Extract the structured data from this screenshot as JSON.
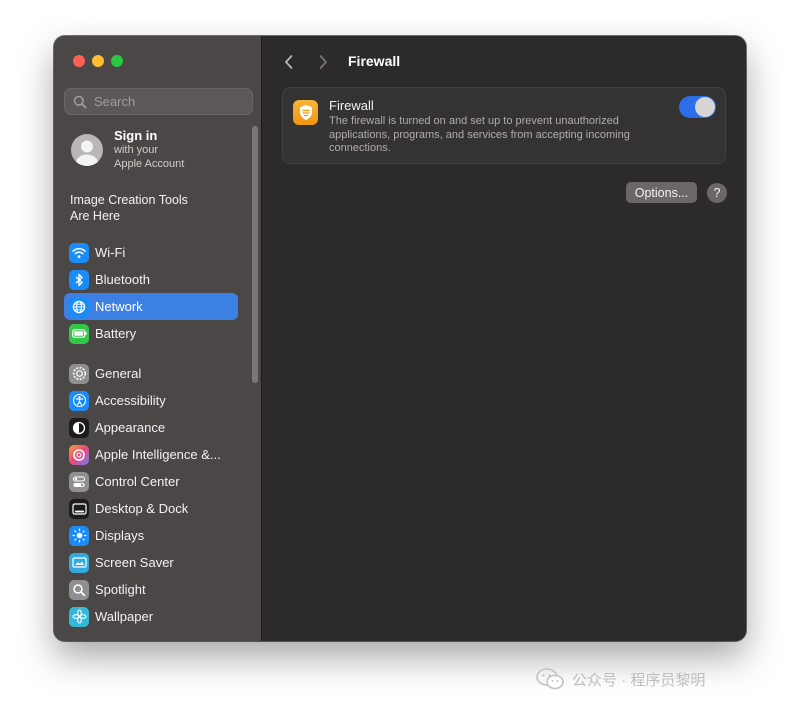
{
  "window": {
    "title": "Firewall"
  },
  "sidebar": {
    "search_placeholder": "Search",
    "account": {
      "title": "Sign in",
      "subtitle_line1": "with your",
      "subtitle_line2": "Apple Account"
    },
    "promo_line1": "Image Creation Tools",
    "promo_line2": "Are Here",
    "group1": [
      {
        "label": "Wi-Fi",
        "icon": "wifi-icon",
        "color": "#1a8cf8",
        "selected": false
      },
      {
        "label": "Bluetooth",
        "icon": "bluetooth-icon",
        "color": "#1a8cf8",
        "selected": false
      },
      {
        "label": "Network",
        "icon": "globe-icon",
        "color": "#1a8cf8",
        "selected": true
      },
      {
        "label": "Battery",
        "icon": "battery-icon",
        "color": "#33c748",
        "selected": false
      }
    ],
    "group2": [
      {
        "label": "General",
        "icon": "gear-icon",
        "color": "#8e8e93",
        "selected": false
      },
      {
        "label": "Accessibility",
        "icon": "accessibility-icon",
        "color": "#1a8cf8",
        "selected": false
      },
      {
        "label": "Appearance",
        "icon": "appearance-icon",
        "color": "#1c1c1e",
        "selected": false
      },
      {
        "label": "Apple Intelligence &...",
        "icon": "apple-intelligence-icon",
        "color": "#e85d8a",
        "selected": false
      },
      {
        "label": "Control Center",
        "icon": "control-center-icon",
        "color": "#8e8e93",
        "selected": false
      },
      {
        "label": "Desktop & Dock",
        "icon": "dock-icon",
        "color": "#1c1c1e",
        "selected": false
      },
      {
        "label": "Displays",
        "icon": "sun-icon",
        "color": "#1a8cf8",
        "selected": false
      },
      {
        "label": "Screen Saver",
        "icon": "screen-saver-icon",
        "color": "#34aadc",
        "selected": false
      },
      {
        "label": "Spotlight",
        "icon": "magnifier-icon",
        "color": "#8e8e93",
        "selected": false
      },
      {
        "label": "Wallpaper",
        "icon": "flower-icon",
        "color": "#34b8d8",
        "selected": false
      }
    ]
  },
  "main": {
    "title": "Firewall",
    "card": {
      "title": "Firewall",
      "description": "The firewall is turned on and set up to prevent unauthorized applications, programs, and services from accepting incoming connections.",
      "toggle_on": true,
      "icon": "firewall-shield-icon",
      "icon_color": "#f5a623"
    },
    "options_label": "Options...",
    "help_label": "?"
  },
  "watermark": {
    "text": "公众号 · 程序员黎明"
  },
  "colors": {
    "accent": "#3d80e4",
    "toggle": "#2c6ee8",
    "sidebar_bg": "#4b4746",
    "main_bg": "#2c2a2a"
  }
}
